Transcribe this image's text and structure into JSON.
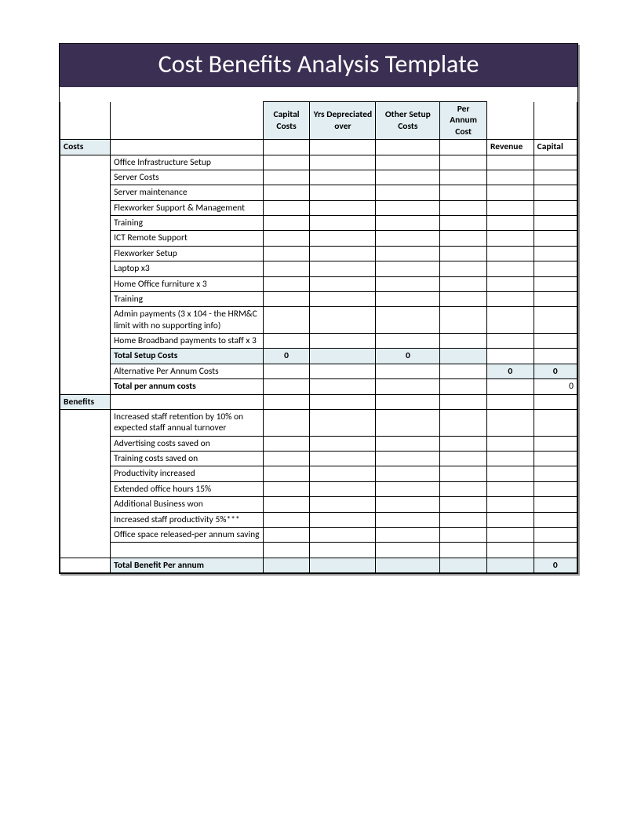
{
  "title": "Cost Benefits Analysis Template",
  "headers": {
    "capital_costs": "Capital Costs",
    "yrs_depreciated": "Yrs Depreciated over",
    "other_setup": "Other Setup Costs",
    "per_annum": "Per Annum Cost"
  },
  "subheaders": {
    "revenue": "Revenue",
    "capital": "Capital"
  },
  "sections": {
    "costs": "Costs",
    "benefits": "Benefits"
  },
  "cost_rows": [
    "Office Infrastructure Setup",
    "Server Costs",
    "Server maintenance",
    "Flexworker Support & Management",
    "Training",
    "ICT Remote Support",
    "Flexworker Setup",
    "Laptop x3",
    "Home Office furniture x 3",
    "Training",
    "Admin payments (3 x 104 - the HRM&C limit with no supporting info)",
    "Home Broadband payments to staff x 3"
  ],
  "totals": {
    "total_setup_label": "Total Setup Costs",
    "total_setup_capital": "0",
    "total_setup_other": "0",
    "alt_per_annum_label": "Alternative Per Annum Costs",
    "alt_per_annum_val1": "0",
    "alt_per_annum_val2": "0",
    "total_per_annum_label": "Total per annum costs",
    "total_per_annum_val": "0",
    "total_benefit_label": "Total Benefit Per annum",
    "total_benefit_val": "0"
  },
  "benefit_rows": [
    "Increased staff retention by 10% on expected staff annual turnover",
    "Advertising costs saved on",
    "Training costs saved on",
    "Productivity increased",
    "Extended office hours 15%",
    "Additional Business won",
    "Increased staff productivity 5%***",
    "Office space released-per annum saving"
  ]
}
